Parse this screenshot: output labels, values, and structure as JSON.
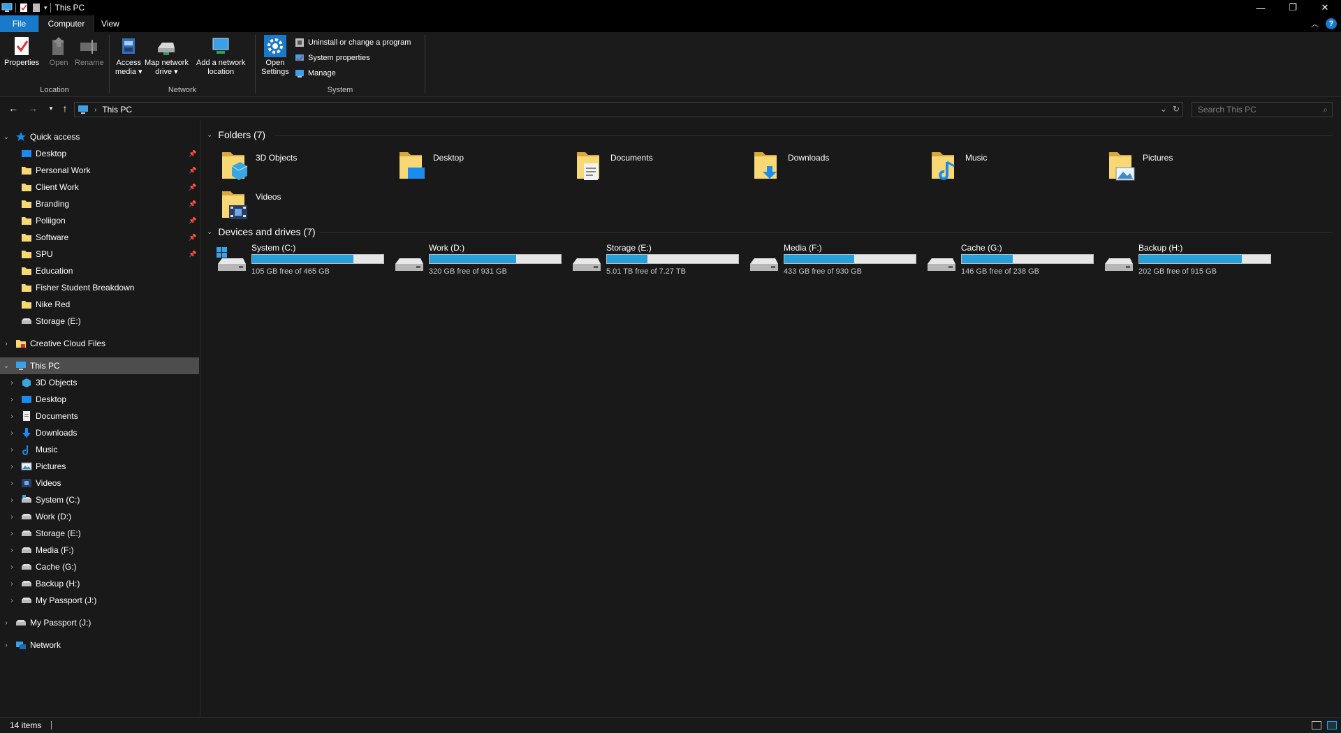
{
  "window": {
    "title": "This PC"
  },
  "ribbon_tabs": {
    "file": "File",
    "computer": "Computer",
    "view": "View"
  },
  "ribbon": {
    "location": {
      "label": "Location",
      "properties": "Properties",
      "open": "Open",
      "rename": "Rename"
    },
    "network": {
      "label": "Network",
      "access_media_1": "Access",
      "access_media_2": "media ▾",
      "map_drive_1": "Map network",
      "map_drive_2": "drive ▾",
      "add_location_1": "Add a network",
      "add_location_2": "location"
    },
    "system": {
      "label": "System",
      "open_settings_1": "Open",
      "open_settings_2": "Settings",
      "uninstall": "Uninstall or change a program",
      "system_properties": "System properties",
      "manage": "Manage"
    }
  },
  "address": {
    "crumb": "This PC",
    "search_placeholder": "Search This PC"
  },
  "nav": {
    "quick_access": "Quick access",
    "quick_items": [
      {
        "label": "Desktop",
        "pinned": true
      },
      {
        "label": "Personal Work",
        "pinned": true
      },
      {
        "label": "Client Work",
        "pinned": true
      },
      {
        "label": "Branding",
        "pinned": true
      },
      {
        "label": "Poliigon",
        "pinned": true
      },
      {
        "label": "Software",
        "pinned": true
      },
      {
        "label": "SPU",
        "pinned": true
      },
      {
        "label": "Education",
        "pinned": false
      },
      {
        "label": "Fisher Student Breakdown",
        "pinned": false
      },
      {
        "label": "Nike Red",
        "pinned": false
      },
      {
        "label": "Storage (E:)",
        "pinned": false
      }
    ],
    "creative_cloud": "Creative Cloud Files",
    "this_pc": "This PC",
    "pc_items": [
      "3D Objects",
      "Desktop",
      "Documents",
      "Downloads",
      "Music",
      "Pictures",
      "Videos",
      "System (C:)",
      "Work (D:)",
      "Storage (E:)",
      "Media (F:)",
      "Cache (G:)",
      "Backup (H:)",
      "My Passport (J:)"
    ],
    "my_passport": "My Passport (J:)",
    "network": "Network"
  },
  "content": {
    "folders_header": "Folders (7)",
    "folders": [
      "3D Objects",
      "Desktop",
      "Documents",
      "Downloads",
      "Music",
      "Pictures",
      "Videos"
    ],
    "drives_header": "Devices and drives (7)",
    "drives": [
      {
        "name": "System (C:)",
        "free": "105 GB free of 465 GB",
        "used_fraction": 0.77
      },
      {
        "name": "Work (D:)",
        "free": "320 GB free of 931 GB",
        "used_fraction": 0.66
      },
      {
        "name": "Storage (E:)",
        "free": "5.01 TB free of 7.27 TB",
        "used_fraction": 0.31
      },
      {
        "name": "Media (F:)",
        "free": "433 GB free of 930 GB",
        "used_fraction": 0.53
      },
      {
        "name": "Cache (G:)",
        "free": "146 GB free of 238 GB",
        "used_fraction": 0.39
      },
      {
        "name": "Backup (H:)",
        "free": "202 GB free of 915 GB",
        "used_fraction": 0.78
      }
    ]
  },
  "status": {
    "items": "14 items"
  },
  "colors": {
    "accent": "#1979ca",
    "drive_bar": "#26a0da",
    "folder": "#f8d775"
  }
}
